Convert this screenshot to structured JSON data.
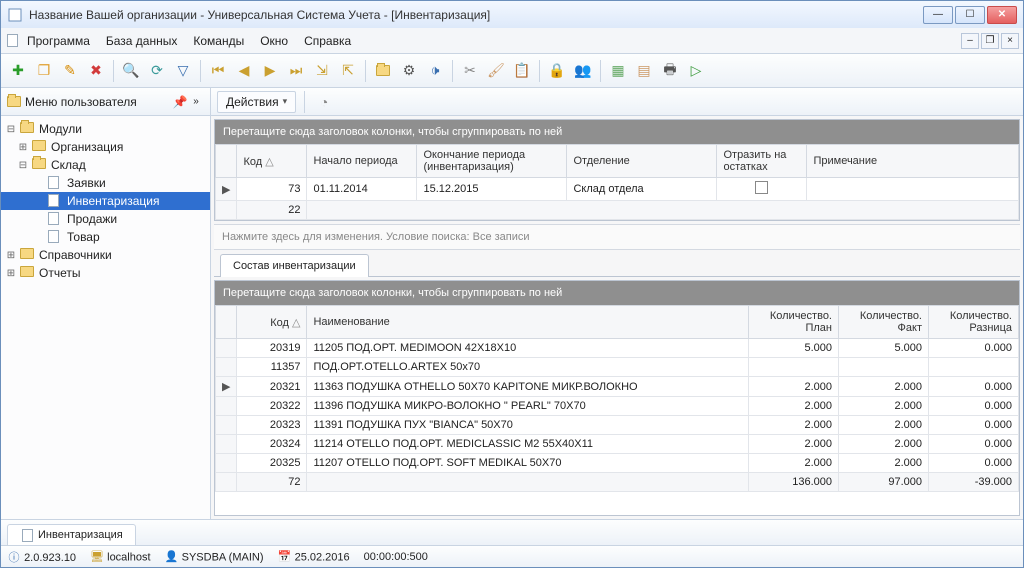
{
  "window": {
    "title": "Название Вашей организации - Универсальная Система Учета - [Инвентаризация]"
  },
  "menu": {
    "items": [
      "Программа",
      "База данных",
      "Команды",
      "Окно",
      "Справка"
    ]
  },
  "sidebar": {
    "header": "Меню пользователя",
    "tree": {
      "root": "Модули",
      "org": "Организация",
      "sklad": "Склад",
      "zayavki": "Заявки",
      "invent": "Инвентаризация",
      "prodazhi": "Продажи",
      "tovar": "Товар",
      "sprav": "Справочники",
      "otchety": "Отчеты"
    }
  },
  "actions": {
    "label": "Действия"
  },
  "top_grid": {
    "group_hint": "Перетащите сюда заголовок колонки, чтобы сгруппировать по ней",
    "cols": {
      "kod": "Код",
      "start": "Начало периода",
      "end": "Окончание периода (инвентаризация)",
      "dept": "Отделение",
      "reflect": "Отразить на остатках",
      "note": "Примечание"
    },
    "row": {
      "kod": "73",
      "start": "01.11.2014",
      "end": "15.12.2015",
      "dept": "Склад отдела",
      "reflect": "",
      "note": ""
    },
    "sum": {
      "kod": "22"
    }
  },
  "filter_hint": "Нажмите здесь для изменения. Условие поиска: Все записи",
  "detail": {
    "tab": "Состав инвентаризации",
    "group_hint": "Перетащите сюда заголовок колонки, чтобы сгруппировать по ней",
    "cols": {
      "kod": "Код",
      "name": "Наименование",
      "plan": "Количество. План",
      "fact": "Количество. Факт",
      "diff": "Количество. Разница"
    },
    "rows": [
      {
        "kod": "20319",
        "name": "11205 ПОД.ОРТ. MEDIMOON 42X18X10",
        "plan": "5.000",
        "fact": "5.000",
        "diff": "0.000"
      },
      {
        "kod": "11357",
        "name": "ПОД.ОРТ.OTELLO.ARTEX 50x70",
        "plan": "",
        "fact": "",
        "diff": ""
      },
      {
        "kod": "20321",
        "name": "11363 ПОДУШКА OTHELLO 50X70 KAPITONE МИКР.ВОЛОКНО",
        "plan": "2.000",
        "fact": "2.000",
        "diff": "0.000",
        "mark": "▶"
      },
      {
        "kod": "20322",
        "name": "11396 ПОДУШКА МИКРО-ВОЛОКНО \" PEARL\" 70X70",
        "plan": "2.000",
        "fact": "2.000",
        "diff": "0.000"
      },
      {
        "kod": "20323",
        "name": "11391 ПОДУШКА ПУХ \"BIANCA\" 50X70",
        "plan": "2.000",
        "fact": "2.000",
        "diff": "0.000"
      },
      {
        "kod": "20324",
        "name": "11214 OTELLO ПОД.ОРТ. MEDICLASSIC M2 55X40X11",
        "plan": "2.000",
        "fact": "2.000",
        "diff": "0.000"
      },
      {
        "kod": "20325",
        "name": "11207 OTELLO ПОД.ОРТ. SOFT MEDIKAL 50X70",
        "plan": "2.000",
        "fact": "2.000",
        "diff": "0.000"
      }
    ],
    "sum": {
      "count": "72",
      "plan": "136.000",
      "fact": "97.000",
      "diff": "-39.000"
    }
  },
  "bottom_tab": "Инвентаризация",
  "status": {
    "version": "2.0.923.10",
    "host": "localhost",
    "user": "SYSDBA (MAIN)",
    "date": "25.02.2016",
    "time": "00:00:00:500"
  }
}
